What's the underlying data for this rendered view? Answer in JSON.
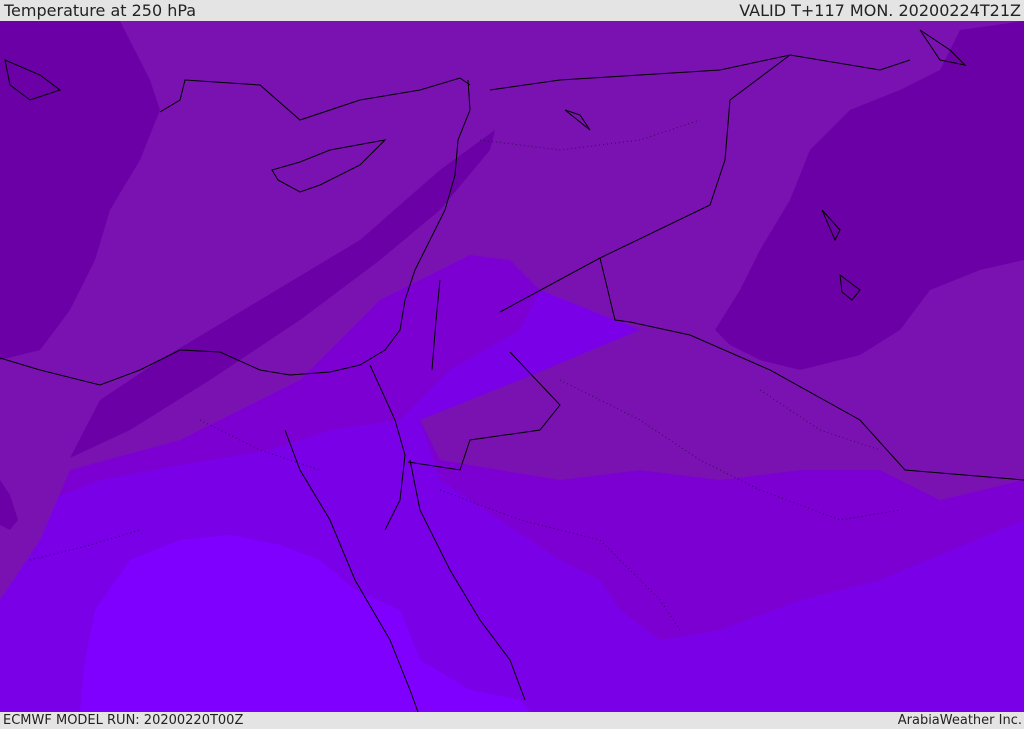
{
  "header": {
    "title": "Temperature at 250 hPa",
    "valid": "VALID T+117 MON. 20200224T21Z"
  },
  "footer": {
    "model_run": "ECMWF MODEL RUN: 20200220T00Z",
    "credit": "ArabiaWeather Inc."
  },
  "colors": {
    "background": "#e4e4e4",
    "band_coldest": "#6a00a6",
    "band_cold": "#7a12b2",
    "band_mid": "#7c00d2",
    "band_warm": "#7a00e8",
    "band_warmest": "#8000ff",
    "coastline": "#000000"
  }
}
